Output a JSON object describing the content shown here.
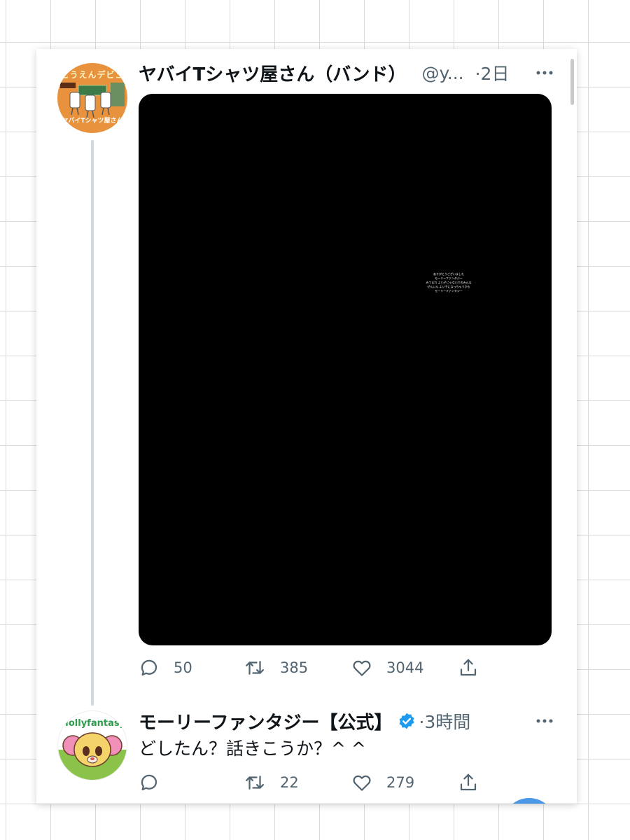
{
  "tweets": [
    {
      "display_name": "ヤバイTシャツ屋さん（バンド）",
      "handle": "@y...",
      "timestamp": "·2日",
      "avatar": {
        "banner_text": "こうえんデビュー",
        "shop_name": "ヤバイTシャツ屋さん"
      },
      "media": {
        "type": "image",
        "overlay_lines": [
          "ありがとうございました",
          "モーリーファンタジー",
          "みつまれ よい子じゃないでのみんな",
          "ぜんいん よい子になっちゃうかも",
          "モーリーファンタジー"
        ]
      },
      "stats": {
        "replies": "50",
        "retweets": "385",
        "likes": "3044"
      }
    },
    {
      "display_name": "モーリーファンタジー【公式】",
      "verified": true,
      "timestamp": "·3時間",
      "text": "どしたん？話きこうか？^ ^",
      "avatar": {
        "logo_text": "Mollyfantasy"
      },
      "stats": {
        "replies": "",
        "retweets": "22",
        "likes": "279"
      }
    }
  ],
  "colors": {
    "text_primary": "#0f1419",
    "text_secondary": "#536471",
    "accent_blue": "#1d9bf0",
    "fab_blue": "#4a99e9",
    "avatar_orange": "#e8923d"
  }
}
